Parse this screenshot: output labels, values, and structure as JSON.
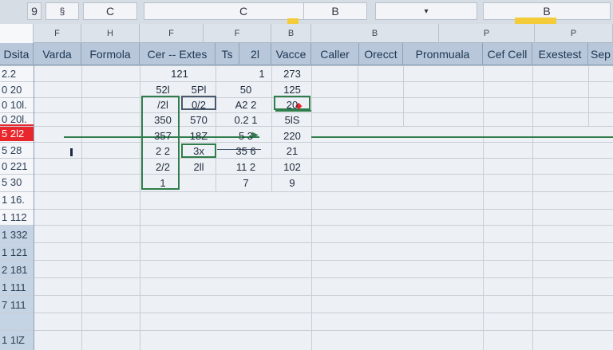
{
  "top_bar": {
    "icon_label": "9",
    "name_box": "C",
    "formula_letter": "C",
    "col_b_label": "B",
    "col_b2_label": "B"
  },
  "column_letters": [
    "F",
    "H",
    "F",
    "F",
    "B",
    "B",
    "P",
    "P"
  ],
  "headers": [
    "Dsita",
    "Varda",
    "Formola",
    "Cer -- Extes",
    "Ts",
    "2l",
    "Vacce",
    "Caller",
    "Orecct",
    "Pronmuala",
    "Cef Cell",
    "Exestest",
    "Sep"
  ],
  "row_labels": [
    "2.2",
    "0 20",
    "0 10l.",
    "0 20l.",
    "5 2l2",
    "5 28",
    "0 221",
    "5 30",
    "1 16.",
    "1 112",
    "1 332",
    "1 121",
    "2 181",
    "1 111",
    "7 111",
    "1 1lZ"
  ],
  "values": {
    "r0c4": "121",
    "r0c6": "1",
    "r0c7": "273",
    "r1c4": "52l",
    "r1c5": "5Pl",
    "r1c6": "50",
    "r1c7": "125",
    "r2c4": "/2l",
    "r2c5": "0/2",
    "r2c6": "A2  2",
    "r2c7": "20",
    "r3c4": "350",
    "r3c5": "570",
    "r3c6": "0.2  1",
    "r3c7": "5lS",
    "r4c4": "357",
    "r4c5": "18Z",
    "r4c6": "5  3",
    "r4c7": "220",
    "r5c4": "2  2",
    "r5c5": "3x",
    "r5c6": "35  6",
    "r5c7": "21",
    "r6c4": "2/2",
    "r6c5": "2ll",
    "r6c6": "11  2",
    "r6c7": "102",
    "r7c4": "1",
    "r7c6": "7",
    "r7c7": "9"
  },
  "colors": {
    "header_bg": "#b8c8da",
    "highlight_red": "#e8262b",
    "accent_yellow": "#f4cc3a",
    "trace_green": "#2f7d4a"
  }
}
